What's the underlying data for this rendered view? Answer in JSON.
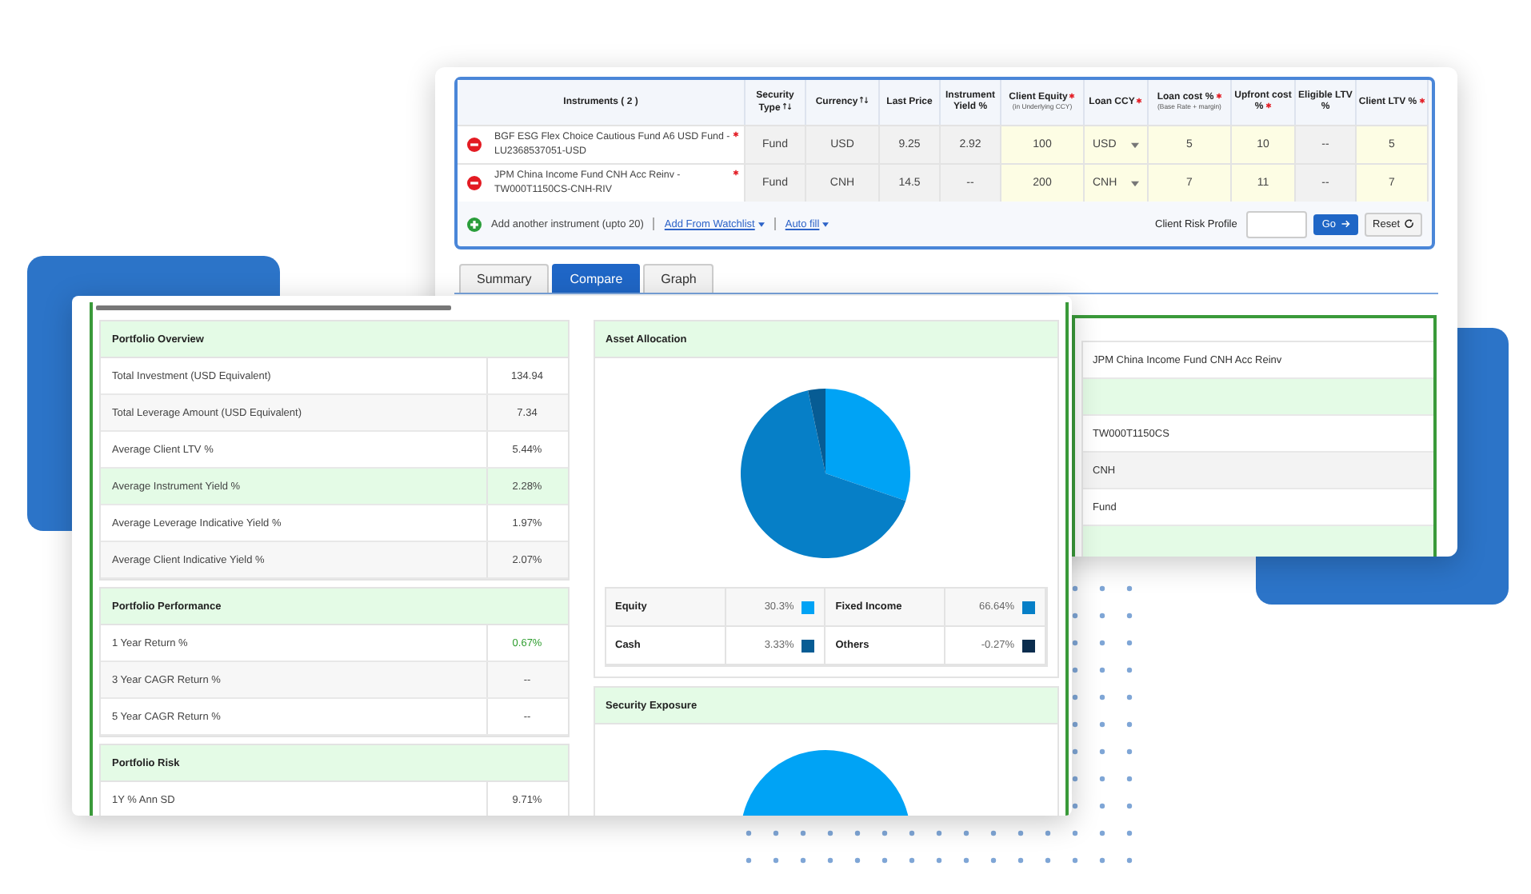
{
  "instrument_table": {
    "columns": [
      {
        "label": "Instruments ( 2 )",
        "sortable": false,
        "required": false
      },
      {
        "label": "Security Type",
        "sortable": true,
        "required": false
      },
      {
        "label": "Currency",
        "sortable": true,
        "required": false
      },
      {
        "label": "Last Price",
        "sortable": false,
        "required": false
      },
      {
        "label": "Instrument Yield %",
        "sortable": false,
        "required": false
      },
      {
        "label": "Client Equity",
        "sublabel": "(in Underlying CCY)",
        "sortable": false,
        "required": true
      },
      {
        "label": "Loan CCY",
        "sortable": false,
        "required": true
      },
      {
        "label": "Loan cost %",
        "sublabel": "(Base Rate + margin)",
        "sortable": false,
        "required": true
      },
      {
        "label": "Upfront cost %",
        "sortable": false,
        "required": true
      },
      {
        "label": "Eligible LTV %",
        "sortable": false,
        "required": false
      },
      {
        "label": "Client LTV %",
        "sortable": false,
        "required": true
      }
    ],
    "rows": [
      {
        "required": true,
        "cells": [
          {
            "kind": "instrument",
            "value": "BGF ESG Flex Choice Cautious Fund A6 USD Fund  - LU2368537051-USD"
          },
          {
            "kind": "readonly",
            "value": "Fund"
          },
          {
            "kind": "readonly",
            "value": "USD"
          },
          {
            "kind": "readonly",
            "value": "9.25"
          },
          {
            "kind": "readonly",
            "value": "2.92"
          },
          {
            "kind": "input",
            "value": "100"
          },
          {
            "kind": "select",
            "value": "USD"
          },
          {
            "kind": "input",
            "value": "5"
          },
          {
            "kind": "input",
            "value": "10"
          },
          {
            "kind": "readonly",
            "value": "--"
          },
          {
            "kind": "input",
            "value": "5"
          }
        ]
      },
      {
        "required": true,
        "cells": [
          {
            "kind": "instrument",
            "value": "JPM China Income Fund CNH Acc Reinv  - TW000T1150CS-CNH-RIV"
          },
          {
            "kind": "readonly",
            "value": "Fund"
          },
          {
            "kind": "readonly",
            "value": "CNH"
          },
          {
            "kind": "readonly",
            "value": "14.5"
          },
          {
            "kind": "readonly",
            "value": "--"
          },
          {
            "kind": "input",
            "value": "200"
          },
          {
            "kind": "select",
            "value": "CNH"
          },
          {
            "kind": "input",
            "value": "7"
          },
          {
            "kind": "input",
            "value": "11"
          },
          {
            "kind": "readonly",
            "value": "--"
          },
          {
            "kind": "input",
            "value": "7"
          }
        ]
      }
    ],
    "add_link": "Add another instrument (upto 20)",
    "menu_links": [
      "Add From Watchlist",
      "Auto fill"
    ],
    "risk_profile_label": "Client Risk Profile",
    "go_button": "Go",
    "reset_button": "Reset"
  },
  "tabs": [
    {
      "label": "Summary",
      "selected": false
    },
    {
      "label": "Compare",
      "selected": true
    },
    {
      "label": "Graph",
      "selected": false
    }
  ],
  "compare_column": [
    {
      "kind": "plain",
      "text": "JPM China Income Fund CNH Acc Reinv"
    },
    {
      "kind": "section"
    },
    {
      "kind": "plain",
      "text": "TW000T1150CS"
    },
    {
      "kind": "stripe",
      "text": "CNH"
    },
    {
      "kind": "plain",
      "text": "Fund"
    },
    {
      "kind": "section"
    }
  ],
  "portfolio_sections": [
    {
      "title": "Portfolio Overview",
      "rows": [
        {
          "label": "Total Investment (USD Equivalent)",
          "value": "134.94",
          "highlighted": false,
          "positive": false
        },
        {
          "label": "Total Leverage Amount (USD Equivalent)",
          "value": "7.34",
          "highlighted": false,
          "positive": false
        },
        {
          "label": "Average Client LTV %",
          "value": "5.44%",
          "highlighted": false,
          "positive": false
        },
        {
          "label": "Average Instrument Yield %",
          "value": "2.28%",
          "highlighted": true,
          "positive": false
        },
        {
          "label": "Average Leverage Indicative Yield %",
          "value": "1.97%",
          "highlighted": false,
          "positive": false
        },
        {
          "label": "Average Client Indicative Yield %",
          "value": "2.07%",
          "highlighted": false,
          "positive": false
        }
      ]
    },
    {
      "title": "Portfolio Performance",
      "rows": [
        {
          "label": "1 Year Return %",
          "value": "0.67%",
          "highlighted": false,
          "positive": true
        },
        {
          "label": "3 Year CAGR Return %",
          "value": "--",
          "highlighted": false,
          "positive": false
        },
        {
          "label": "5 Year CAGR Return %",
          "value": "--",
          "highlighted": false,
          "positive": false
        }
      ]
    },
    {
      "title": "Portfolio Risk",
      "rows": [
        {
          "label": "1Y % Ann SD",
          "value": "9.71%",
          "highlighted": false,
          "positive": false
        }
      ]
    }
  ],
  "asset_allocation": {
    "title": "Asset Allocation",
    "legend": [
      {
        "label": "Equity",
        "value": "30.3%",
        "color": "#00a3f5"
      },
      {
        "label": "Fixed Income",
        "value": "66.64%",
        "color": "#067fc7"
      },
      {
        "label": "Cash",
        "value": "3.33%",
        "color": "#075c94"
      },
      {
        "label": "Others",
        "value": "-0.27%",
        "color": "#0b2d4e"
      }
    ]
  },
  "security_exposure": {
    "title": "Security Exposure"
  }
}
